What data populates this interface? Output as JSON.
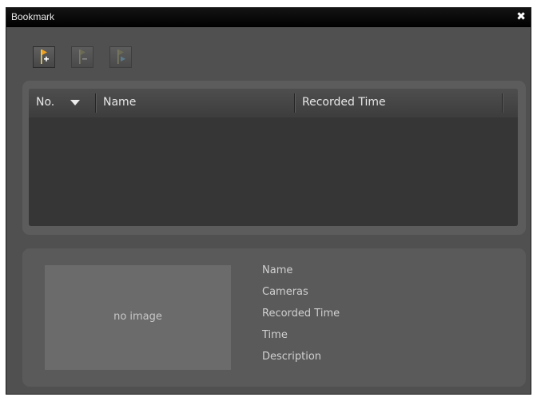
{
  "window": {
    "title": "Bookmark",
    "close_glyph": "✖"
  },
  "toolbar": {
    "buttons": [
      {
        "name": "add-bookmark",
        "icon": "flag-add-icon",
        "enabled": true
      },
      {
        "name": "remove-bookmark",
        "icon": "flag-remove-icon",
        "enabled": false
      },
      {
        "name": "go-to-bookmark",
        "icon": "flag-play-icon",
        "enabled": false
      }
    ]
  },
  "list": {
    "columns": [
      {
        "label": "No.",
        "sort": "descending"
      },
      {
        "label": "Name"
      },
      {
        "label": "Recorded Time"
      }
    ],
    "rows": []
  },
  "detail": {
    "thumbnail_placeholder": "no image",
    "fields": [
      {
        "label": "Name"
      },
      {
        "label": "Cameras"
      },
      {
        "label": "Recorded Time"
      },
      {
        "label": "Time"
      },
      {
        "label": "Description"
      }
    ]
  },
  "colors": {
    "window_bg": "#505050",
    "titlebar": "#000000",
    "flag_active": "#f0a020",
    "flag_disabled": "#6b6b55"
  }
}
